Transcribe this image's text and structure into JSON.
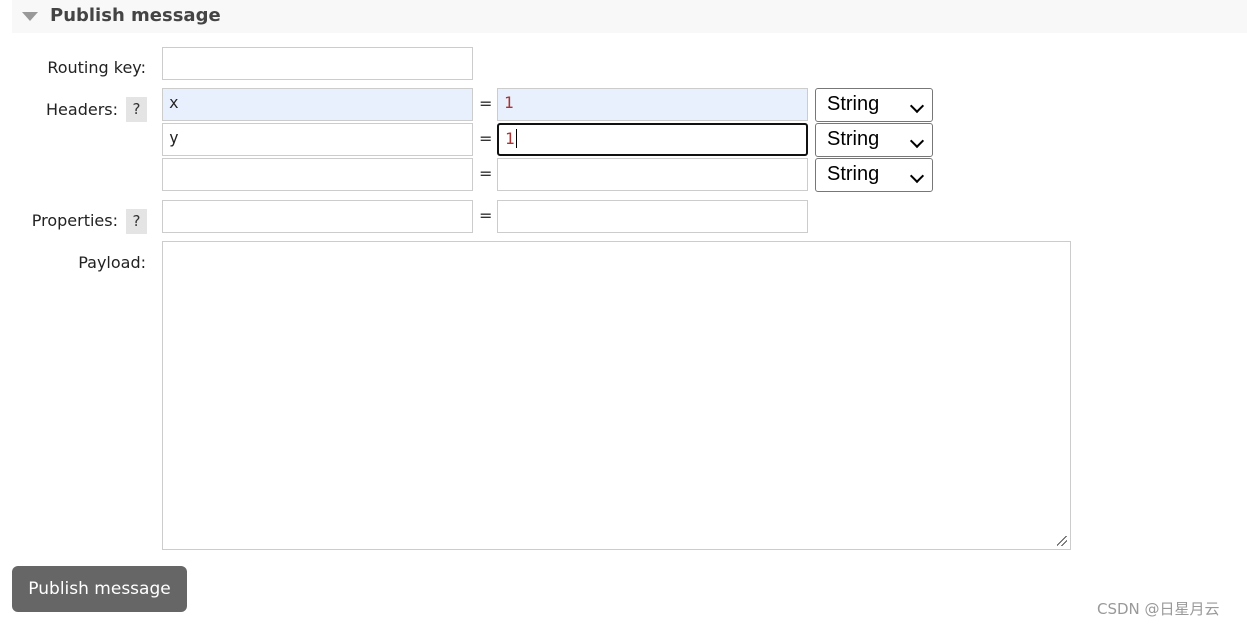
{
  "section": {
    "title": "Publish message",
    "icon": "triangle-down-icon"
  },
  "form": {
    "routing_key_label": "Routing key:",
    "routing_key_value": "",
    "headers_label": "Headers:",
    "help": "?",
    "headers": [
      {
        "key": "x",
        "value": "1",
        "type": "String"
      },
      {
        "key": "y",
        "value": "1",
        "type": "String"
      },
      {
        "key": "",
        "value": "",
        "type": "String"
      }
    ],
    "equals": "=",
    "properties_label": "Properties:",
    "properties": {
      "key": "",
      "value": ""
    },
    "payload_label": "Payload:",
    "payload": ""
  },
  "button": {
    "label": "Publish message"
  },
  "watermark": "CSDN @日星月云"
}
